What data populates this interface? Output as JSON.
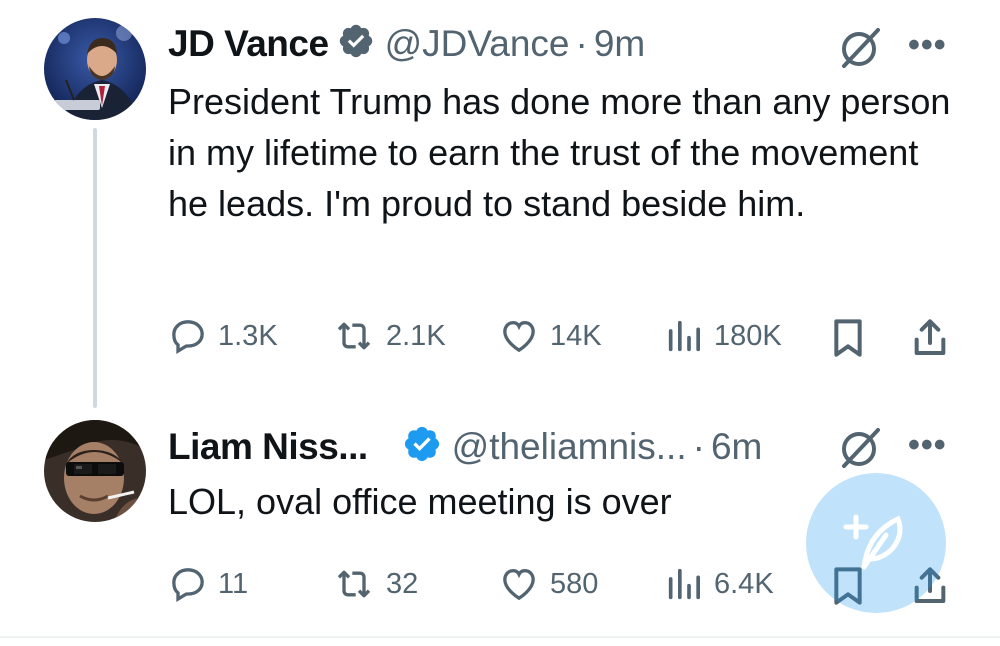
{
  "tweets": [
    {
      "name": "JD Vance",
      "handle": "@JDVance",
      "separator": "·",
      "time": "9m",
      "text": "President Trump has done more than any person in my lifetime to earn the trust of the movement he leads. I'm proud to stand beside him.",
      "more": "•••",
      "replies": "1.3K",
      "reposts": "2.1K",
      "likes": "14K",
      "views": "180K"
    },
    {
      "name": "Liam Niss...",
      "handle": "@theliamnis...",
      "separator": "·",
      "time": "6m",
      "text": "LOL, oval office meeting is over",
      "more": "•••",
      "replies": "11",
      "reposts": "32",
      "likes": "580",
      "views": "6.4K"
    }
  ],
  "colors": {
    "verified": "#1d9bf0",
    "muted": "#536471",
    "text": "#0f1419",
    "thread_line": "#cfd9de",
    "fab": "#1d9bf0"
  },
  "icons": [
    "verified-badge-icon",
    "grok-icon",
    "more-icon",
    "reply-icon",
    "repost-icon",
    "like-icon",
    "views-icon",
    "bookmark-icon",
    "share-icon",
    "compose-post-icon"
  ]
}
